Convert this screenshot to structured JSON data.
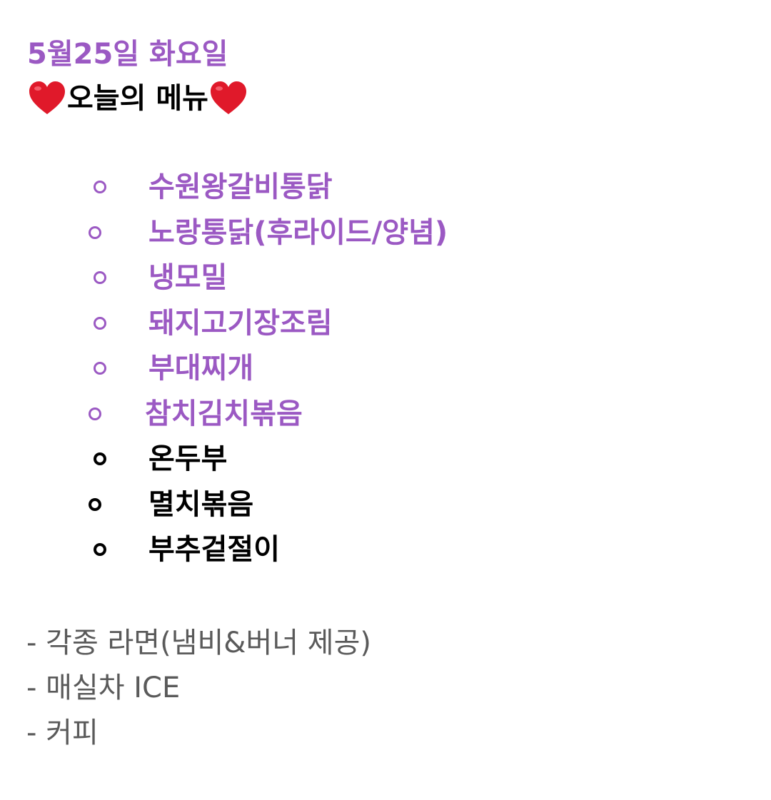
{
  "header": {
    "date": "5월25일 화요일",
    "title": "오늘의 메뉴"
  },
  "colors": {
    "accent": "#9b59c3",
    "heart": "#e0192a",
    "black": "#000000",
    "gray": "#5a5a5a"
  },
  "menu": {
    "items": [
      {
        "label": "수원왕갈비통닭",
        "color": "purple"
      },
      {
        "label": "노랑통닭(후라이드/양념)",
        "color": "purple"
      },
      {
        "label": "냉모밀",
        "color": "purple"
      },
      {
        "label": "돼지고기장조림",
        "color": "purple"
      },
      {
        "label": "부대찌개",
        "color": "purple"
      },
      {
        "label": "참치김치볶음",
        "color": "purple"
      },
      {
        "label": "온두부",
        "color": "black"
      },
      {
        "label": "멸치볶음",
        "color": "black"
      },
      {
        "label": "부추겉절이",
        "color": "black"
      }
    ]
  },
  "extras": {
    "items": [
      "- 각종 라면(냄비&버너 제공)",
      "- 매실차 ICE",
      "- 커피"
    ]
  }
}
